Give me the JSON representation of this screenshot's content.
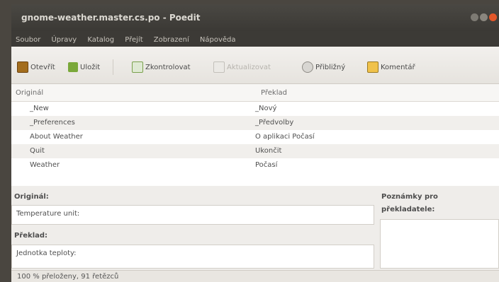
{
  "window": {
    "title": "gnome-weather.master.cs.po - Poedit"
  },
  "menu": [
    "Soubor",
    "Úpravy",
    "Katalog",
    "Přejít",
    "Zobrazení",
    "Nápověda"
  ],
  "toolbar": {
    "open": "Otevřít",
    "save": "Uložit",
    "validate": "Zkontrolovat",
    "update": "Aktualizovat",
    "fuzzy": "Přibližný",
    "comment": "Komentář"
  },
  "list": {
    "col_original": "Originál",
    "col_translation": "Překlad",
    "rows": [
      {
        "source": "_New",
        "translation": "_Nový"
      },
      {
        "source": "_Preferences",
        "translation": "_Předvolby"
      },
      {
        "source": "About Weather",
        "translation": "O aplikaci Počasí"
      },
      {
        "source": "Quit",
        "translation": "Ukončit"
      },
      {
        "source": "Weather",
        "translation": "Počasí"
      }
    ]
  },
  "editor": {
    "original_label": "Originál:",
    "original_text": "Temperature unit:",
    "translation_label": "Překlad:",
    "translation_text": "Jednotka teploty:",
    "notes_label_line1": "Poznámky pro",
    "notes_label_line2": "překladatele:"
  },
  "status": {
    "text": "100 % přeloženy, 91 řetězců"
  },
  "colors": {
    "titlebar": "#3b3935",
    "close": "#e2572a",
    "minimize": "#8a867e"
  }
}
